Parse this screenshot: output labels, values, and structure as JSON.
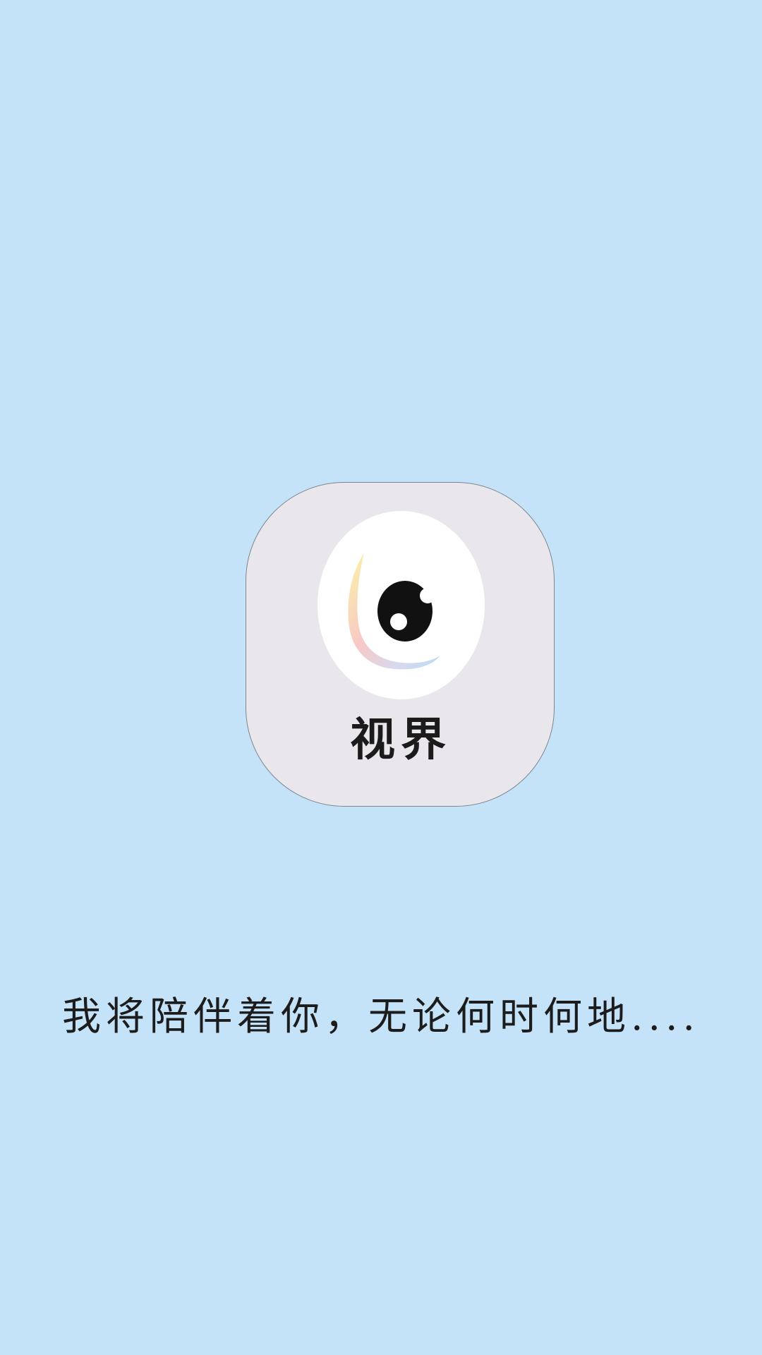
{
  "splash": {
    "background_color": "#c4e3f8",
    "app_name": "视界",
    "logo_icon": "eye-icon",
    "tagline": "我将陪伴着你，无论何时何地...."
  },
  "colors": {
    "icon_tile": "#e9e7eb",
    "logo_disc": "#ffffff",
    "pupil": "#111111",
    "text": "#1c1c1c"
  }
}
